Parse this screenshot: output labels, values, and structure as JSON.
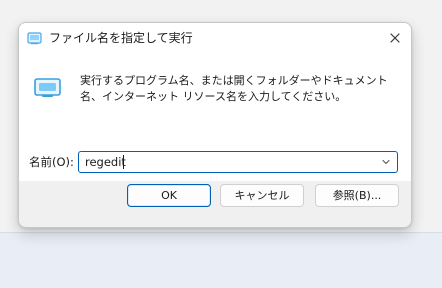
{
  "window": {
    "title": "ファイル名を指定して実行",
    "close_icon": "close-icon"
  },
  "content": {
    "description": "実行するプログラム名、または開くフォルダーやドキュメント名、インターネット リソース名を入力してください。",
    "name_label": "名前(O):",
    "input_value": "regedit"
  },
  "buttons": {
    "ok": "OK",
    "cancel": "キャンセル",
    "browse": "参照(B)..."
  },
  "colors": {
    "accent": "#005fb8",
    "dialog_bg": "#f0f0f0",
    "content_bg": "#ffffff"
  }
}
